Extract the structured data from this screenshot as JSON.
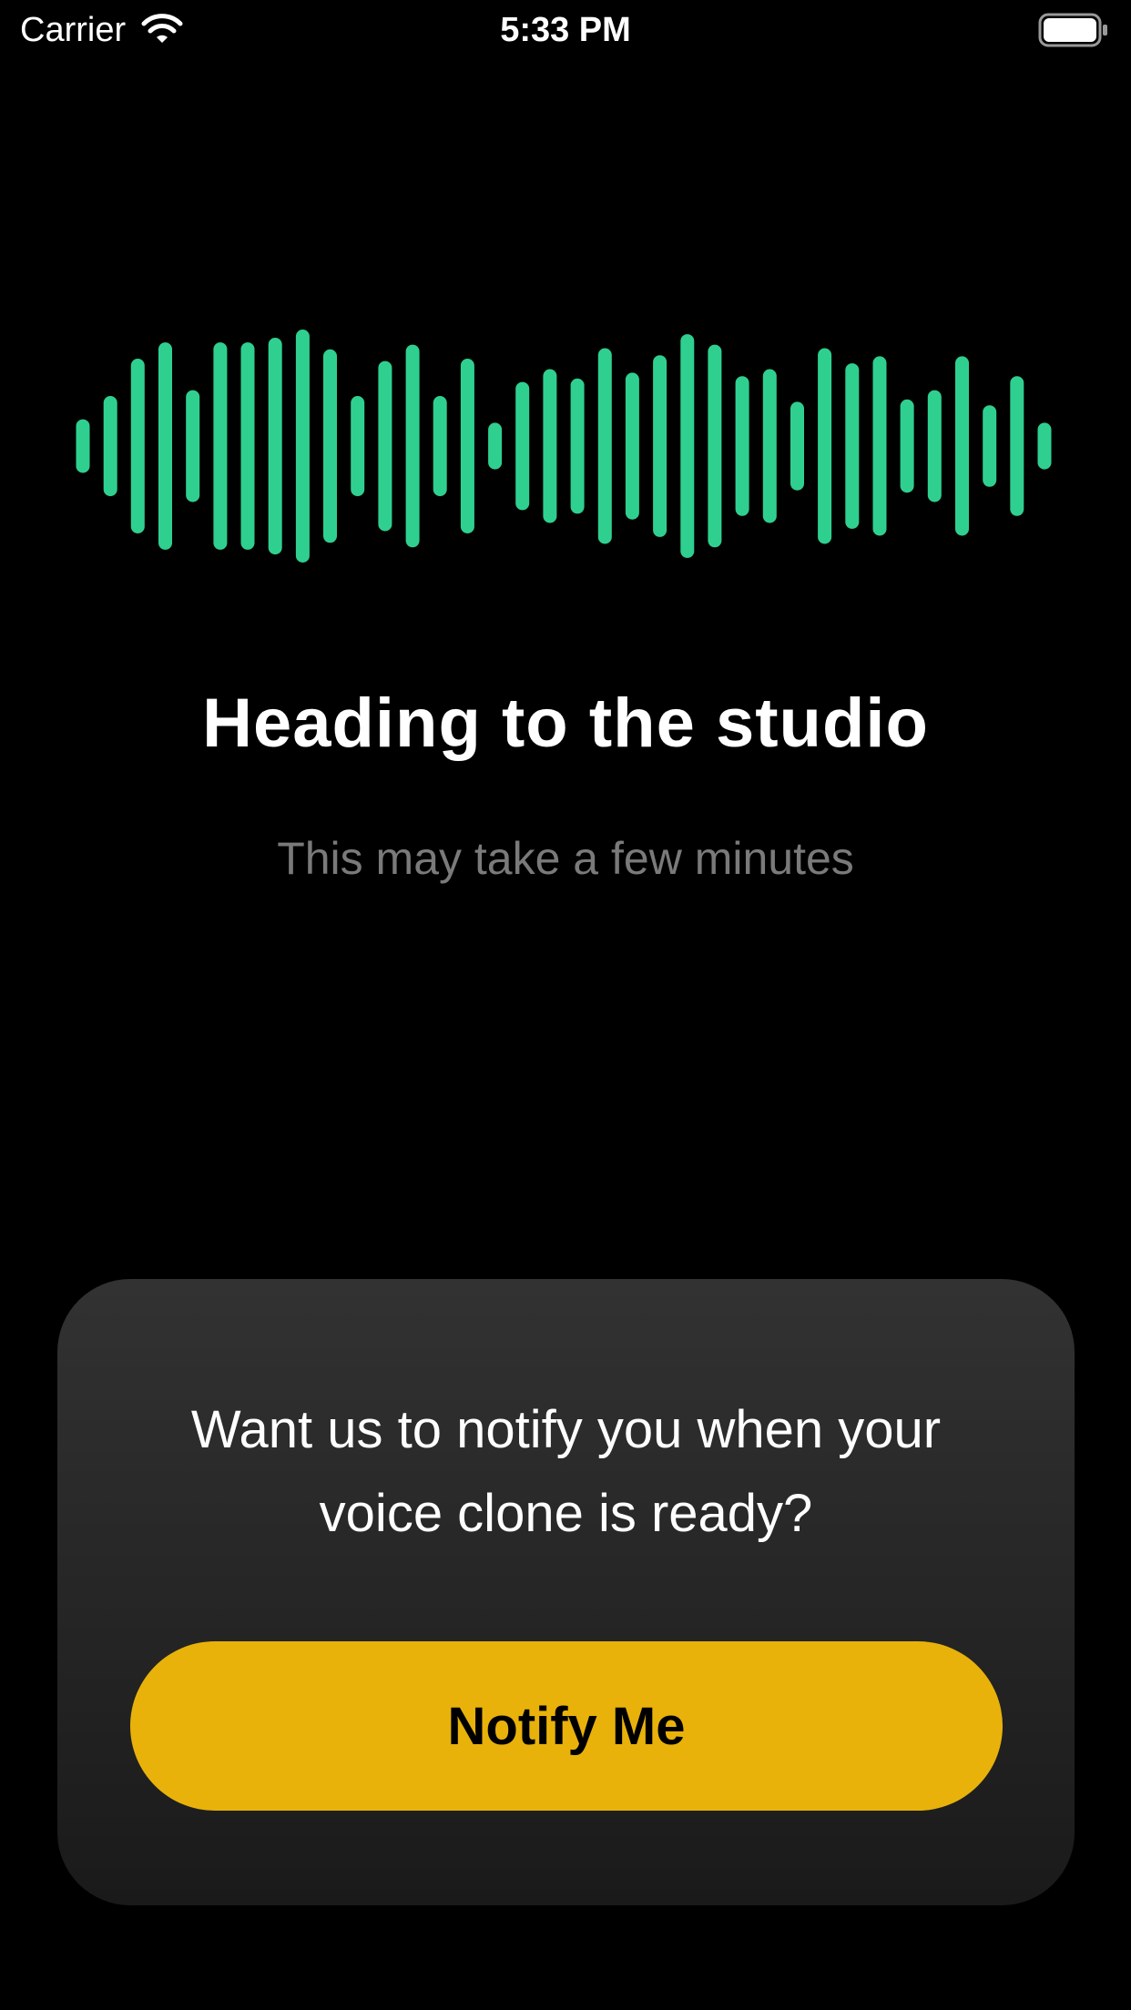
{
  "status_bar": {
    "carrier": "Carrier",
    "time": "5:33 PM",
    "wifi_icon": "wifi-icon",
    "battery_icon": "battery-icon"
  },
  "waveform": {
    "color": "#2fd08f",
    "icon": "audio-waveform-icon",
    "levels": [
      0.23,
      0.43,
      0.75,
      0.89,
      0.48,
      0.89,
      0.89,
      0.93,
      1.0,
      0.83,
      0.43,
      0.73,
      0.87,
      0.43,
      0.75,
      0.2,
      0.55,
      0.66,
      0.58,
      0.84,
      0.63,
      0.78,
      0.96,
      0.87,
      0.6,
      0.66,
      0.38,
      0.84,
      0.71,
      0.77,
      0.4,
      0.48,
      0.77,
      0.35,
      0.6,
      0.2
    ]
  },
  "main": {
    "title": "Heading to the studio",
    "subtitle": "This may take a few minutes"
  },
  "card": {
    "question": "Want us to notify you when your voice clone is ready?",
    "button_label": "Notify Me",
    "button_color": "#e8b20b"
  }
}
